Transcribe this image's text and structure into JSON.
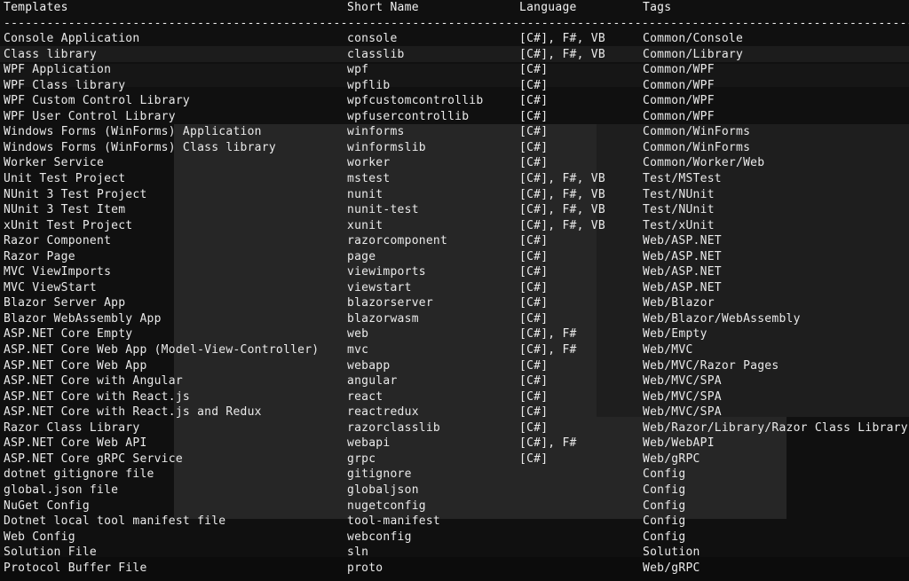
{
  "header": {
    "templates": "Templates",
    "short_name": "Short Name",
    "language": "Language",
    "tags": "Tags"
  },
  "separator": "--------------------------------------------------------------------------------------------------------------------------------------------",
  "rows": [
    {
      "template": "Console Application",
      "short": "console",
      "lang": "[C#], F#, VB",
      "tags": "Common/Console"
    },
    {
      "template": "Class library",
      "short": "classlib",
      "lang": "[C#], F#, VB",
      "tags": "Common/Library"
    },
    {
      "template": "WPF Application",
      "short": "wpf",
      "lang": "[C#]",
      "tags": "Common/WPF"
    },
    {
      "template": "WPF Class library",
      "short": "wpflib",
      "lang": "[C#]",
      "tags": "Common/WPF"
    },
    {
      "template": "WPF Custom Control Library",
      "short": "wpfcustomcontrollib",
      "lang": "[C#]",
      "tags": "Common/WPF"
    },
    {
      "template": "WPF User Control Library",
      "short": "wpfusercontrollib",
      "lang": "[C#]",
      "tags": "Common/WPF"
    },
    {
      "template": "Windows Forms (WinForms) Application",
      "short": "winforms",
      "lang": "[C#]",
      "tags": "Common/WinForms"
    },
    {
      "template": "Windows Forms (WinForms) Class library",
      "short": "winformslib",
      "lang": "[C#]",
      "tags": "Common/WinForms"
    },
    {
      "template": "Worker Service",
      "short": "worker",
      "lang": "[C#]",
      "tags": "Common/Worker/Web"
    },
    {
      "template": "Unit Test Project",
      "short": "mstest",
      "lang": "[C#], F#, VB",
      "tags": "Test/MSTest"
    },
    {
      "template": "NUnit 3 Test Project",
      "short": "nunit",
      "lang": "[C#], F#, VB",
      "tags": "Test/NUnit"
    },
    {
      "template": "NUnit 3 Test Item",
      "short": "nunit-test",
      "lang": "[C#], F#, VB",
      "tags": "Test/NUnit"
    },
    {
      "template": "xUnit Test Project",
      "short": "xunit",
      "lang": "[C#], F#, VB",
      "tags": "Test/xUnit"
    },
    {
      "template": "Razor Component",
      "short": "razorcomponent",
      "lang": "[C#]",
      "tags": "Web/ASP.NET"
    },
    {
      "template": "Razor Page",
      "short": "page",
      "lang": "[C#]",
      "tags": "Web/ASP.NET"
    },
    {
      "template": "MVC ViewImports",
      "short": "viewimports",
      "lang": "[C#]",
      "tags": "Web/ASP.NET"
    },
    {
      "template": "MVC ViewStart",
      "short": "viewstart",
      "lang": "[C#]",
      "tags": "Web/ASP.NET"
    },
    {
      "template": "Blazor Server App",
      "short": "blazorserver",
      "lang": "[C#]",
      "tags": "Web/Blazor"
    },
    {
      "template": "Blazor WebAssembly App",
      "short": "blazorwasm",
      "lang": "[C#]",
      "tags": "Web/Blazor/WebAssembly"
    },
    {
      "template": "ASP.NET Core Empty",
      "short": "web",
      "lang": "[C#], F#",
      "tags": "Web/Empty"
    },
    {
      "template": "ASP.NET Core Web App (Model-View-Controller)",
      "short": "mvc",
      "lang": "[C#], F#",
      "tags": "Web/MVC"
    },
    {
      "template": "ASP.NET Core Web App",
      "short": "webapp",
      "lang": "[C#]",
      "tags": "Web/MVC/Razor Pages"
    },
    {
      "template": "ASP.NET Core with Angular",
      "short": "angular",
      "lang": "[C#]",
      "tags": "Web/MVC/SPA"
    },
    {
      "template": "ASP.NET Core with React.js",
      "short": "react",
      "lang": "[C#]",
      "tags": "Web/MVC/SPA"
    },
    {
      "template": "ASP.NET Core with React.js and Redux",
      "short": "reactredux",
      "lang": "[C#]",
      "tags": "Web/MVC/SPA"
    },
    {
      "template": "Razor Class Library",
      "short": "razorclasslib",
      "lang": "[C#]",
      "tags": "Web/Razor/Library/Razor Class Library"
    },
    {
      "template": "ASP.NET Core Web API",
      "short": "webapi",
      "lang": "[C#], F#",
      "tags": "Web/WebAPI"
    },
    {
      "template": "ASP.NET Core gRPC Service",
      "short": "grpc",
      "lang": "[C#]",
      "tags": "Web/gRPC"
    },
    {
      "template": "dotnet gitignore file",
      "short": "gitignore",
      "lang": "",
      "tags": "Config"
    },
    {
      "template": "global.json file",
      "short": "globaljson",
      "lang": "",
      "tags": "Config"
    },
    {
      "template": "NuGet Config",
      "short": "nugetconfig",
      "lang": "",
      "tags": "Config"
    },
    {
      "template": "Dotnet local tool manifest file",
      "short": "tool-manifest",
      "lang": "",
      "tags": "Config"
    },
    {
      "template": "Web Config",
      "short": "webconfig",
      "lang": "",
      "tags": "Config"
    },
    {
      "template": "Solution File",
      "short": "sln",
      "lang": "",
      "tags": "Solution"
    },
    {
      "template": "Protocol Buffer File",
      "short": "proto",
      "lang": "",
      "tags": "Web/gRPC"
    }
  ]
}
